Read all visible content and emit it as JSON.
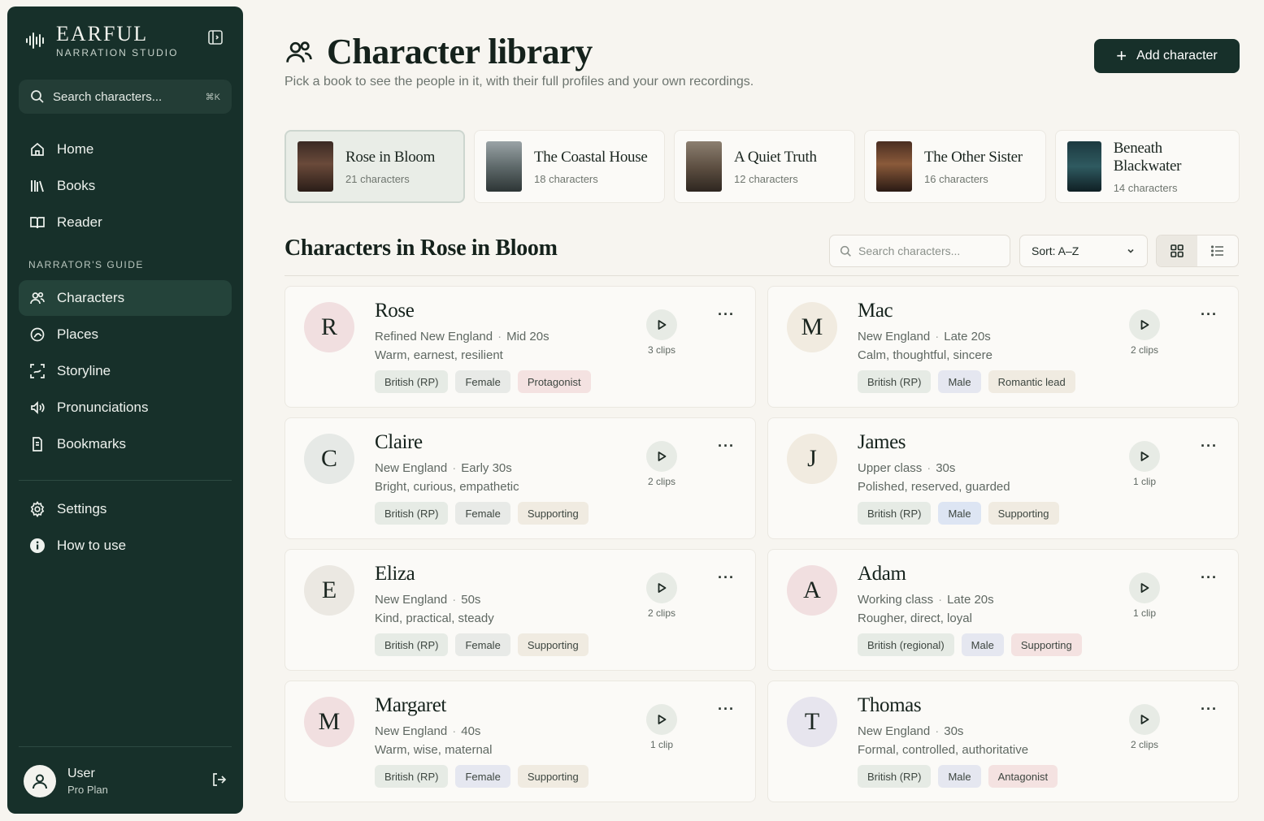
{
  "brand": {
    "name": "EARFUL",
    "subtitle": "NARRATION STUDIO"
  },
  "sidebar": {
    "search_placeholder": "Search characters...",
    "search_shortcut": "⌘K",
    "nav_main": [
      {
        "label": "Home",
        "icon": "home-icon"
      },
      {
        "label": "Books",
        "icon": "books-icon"
      },
      {
        "label": "Reader",
        "icon": "book-open-icon"
      }
    ],
    "section_label": "NARRATOR'S GUIDE",
    "nav_guide": [
      {
        "label": "Characters",
        "icon": "users-icon",
        "active": true
      },
      {
        "label": "Places",
        "icon": "map-pin-icon"
      },
      {
        "label": "Storyline",
        "icon": "storyline-icon"
      },
      {
        "label": "Pronunciations",
        "icon": "speaker-icon"
      },
      {
        "label": "Bookmarks",
        "icon": "bookmark-icon"
      }
    ],
    "nav_bottom": [
      {
        "label": "Settings",
        "icon": "gear-icon"
      },
      {
        "label": "How to use",
        "icon": "info-icon"
      }
    ],
    "user": {
      "name": "User",
      "plan": "Pro Plan"
    }
  },
  "header": {
    "title": "Character library",
    "subtitle": "Pick a book to see the people in it, with their full profiles and your own recordings.",
    "add_label": "Add character"
  },
  "books": [
    {
      "title": "Rose in Bloom",
      "count": "21 characters",
      "active": true
    },
    {
      "title": "The Coastal House",
      "count": "18 characters"
    },
    {
      "title": "A Quiet Truth",
      "count": "12 characters"
    },
    {
      "title": "The Other Sister",
      "count": "16 characters"
    },
    {
      "title": "Beneath Blackwater",
      "count": "14 characters"
    }
  ],
  "list": {
    "title": "Characters in Rose in Bloom",
    "search_placeholder": "Search characters...",
    "sort_label": "Sort: A–Z"
  },
  "colors": {
    "sidebar_bg": "#17302a",
    "accent": "#17302a",
    "avatar_rose": "#f1dfe0",
    "avatar_sage": "#e6e9e6",
    "avatar_cream": "#f1ebe0",
    "avatar_lavender": "#e7e5ee",
    "tag_sage": "#e6ebe5",
    "tag_sand": "#f0ebe1",
    "tag_pink": "#f4e2e1",
    "tag_lavender": "#e5e7f0",
    "tag_blue": "#dde5f3"
  },
  "characters": [
    {
      "initial": "R",
      "name": "Rose",
      "region": "Refined New England",
      "age": "Mid 20s",
      "traits": "Warm, earnest, resilient",
      "clips": "3 clips",
      "avatar": "#f1dfe0",
      "tags": [
        {
          "label": "British (RP)",
          "bg": "#e6ebe5"
        },
        {
          "label": "Female",
          "bg": "#e8eae7"
        },
        {
          "label": "Protagonist",
          "bg": "#f4e2e1"
        }
      ]
    },
    {
      "initial": "M",
      "name": "Mac",
      "region": "New England",
      "age": "Late 20s",
      "traits": "Calm, thoughtful, sincere",
      "clips": "2 clips",
      "avatar": "#f1ebe0",
      "tags": [
        {
          "label": "British (RP)",
          "bg": "#e6ebe5"
        },
        {
          "label": "Male",
          "bg": "#e5e7f0"
        },
        {
          "label": "Romantic lead",
          "bg": "#f0ebe1"
        }
      ]
    },
    {
      "initial": "C",
      "name": "Claire",
      "region": "New England",
      "age": "Early 30s",
      "traits": "Bright, curious, empathetic",
      "clips": "2 clips",
      "avatar": "#e6e9e6",
      "tags": [
        {
          "label": "British (RP)",
          "bg": "#e6ebe5"
        },
        {
          "label": "Female",
          "bg": "#e8eae7"
        },
        {
          "label": "Supporting",
          "bg": "#f0ebe1"
        }
      ]
    },
    {
      "initial": "J",
      "name": "James",
      "region": "Upper class",
      "age": "30s",
      "traits": "Polished, reserved, guarded",
      "clips": "1 clip",
      "avatar": "#f1ebe0",
      "tags": [
        {
          "label": "British (RP)",
          "bg": "#e6ebe5"
        },
        {
          "label": "Male",
          "bg": "#dde5f3"
        },
        {
          "label": "Supporting",
          "bg": "#f0ebe1"
        }
      ]
    },
    {
      "initial": "E",
      "name": "Eliza",
      "region": "New England",
      "age": "50s",
      "traits": "Kind, practical, steady",
      "clips": "2 clips",
      "avatar": "#ebe8e2",
      "tags": [
        {
          "label": "British (RP)",
          "bg": "#e6ebe5"
        },
        {
          "label": "Female",
          "bg": "#e8eae7"
        },
        {
          "label": "Supporting",
          "bg": "#f0ebe1"
        }
      ]
    },
    {
      "initial": "A",
      "name": "Adam",
      "region": "Working class",
      "age": "Late 20s",
      "traits": "Rougher, direct, loyal",
      "clips": "1 clip",
      "avatar": "#f1dfe0",
      "tags": [
        {
          "label": "British (regional)",
          "bg": "#e6ebe5"
        },
        {
          "label": "Male",
          "bg": "#e5e7f0"
        },
        {
          "label": "Supporting",
          "bg": "#f4e2e1"
        }
      ]
    },
    {
      "initial": "M",
      "name": "Margaret",
      "region": "New England",
      "age": "40s",
      "traits": "Warm, wise, maternal",
      "clips": "1 clip",
      "avatar": "#f1dfe0",
      "tags": [
        {
          "label": "British (RP)",
          "bg": "#e6ebe5"
        },
        {
          "label": "Female",
          "bg": "#e5e7f0"
        },
        {
          "label": "Supporting",
          "bg": "#f0ebe1"
        }
      ]
    },
    {
      "initial": "T",
      "name": "Thomas",
      "region": "New England",
      "age": "30s",
      "traits": "Formal, controlled, authoritative",
      "clips": "2 clips",
      "avatar": "#e7e5ee",
      "tags": [
        {
          "label": "British (RP)",
          "bg": "#e6ebe5"
        },
        {
          "label": "Male",
          "bg": "#e5e7f0"
        },
        {
          "label": "Antagonist",
          "bg": "#f4e2e1"
        }
      ]
    }
  ]
}
